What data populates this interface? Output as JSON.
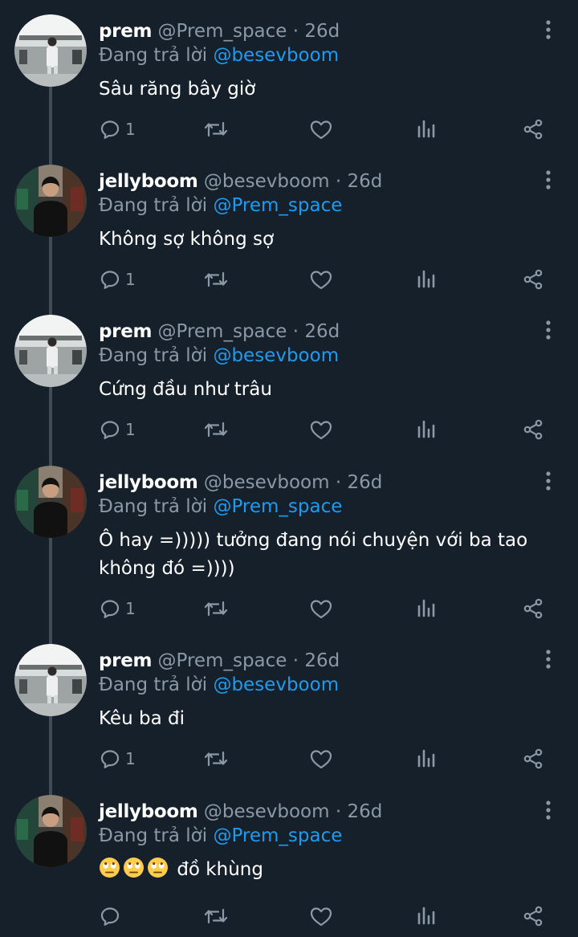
{
  "reply_prefix": "Đang trả lời",
  "tweets": [
    {
      "name": "prem",
      "handle": "@Prem_space",
      "time": "26d",
      "reply_to": "@besevboom",
      "text": "Sâu răng bây giờ",
      "emoji_count": 0,
      "reply_count": "1",
      "avatar": "prem"
    },
    {
      "name": "jellyboom",
      "handle": "@besevboom",
      "time": "26d",
      "reply_to": "@Prem_space",
      "text": "Không sợ không sợ",
      "emoji_count": 0,
      "reply_count": "1",
      "avatar": "jelly"
    },
    {
      "name": "prem",
      "handle": "@Prem_space",
      "time": "26d",
      "reply_to": "@besevboom",
      "text": "Cứng đầu như trâu",
      "emoji_count": 0,
      "reply_count": "1",
      "avatar": "prem"
    },
    {
      "name": "jellyboom",
      "handle": "@besevboom",
      "time": "26d",
      "reply_to": "@Prem_space",
      "text": "Ô hay =))))) tưởng đang nói chuyện với ba tao không đó =))))",
      "emoji_count": 0,
      "reply_count": "1",
      "avatar": "jelly"
    },
    {
      "name": "prem",
      "handle": "@Prem_space",
      "time": "26d",
      "reply_to": "@besevboom",
      "text": "Kêu ba đi",
      "emoji_count": 0,
      "reply_count": "1",
      "avatar": "prem"
    },
    {
      "name": "jellyboom",
      "handle": "@besevboom",
      "time": "26d",
      "reply_to": "@Prem_space",
      "text": "đồ khùng",
      "emoji_count": 3,
      "emoji": "face-with-rolling-eyes",
      "reply_count": "",
      "avatar": "jelly"
    }
  ],
  "icons": {
    "reply": "reply-icon",
    "retweet": "retweet-icon",
    "like": "like-icon",
    "views": "views-icon",
    "share": "share-icon",
    "more": "more-icon"
  },
  "colors": {
    "background": "#15202b",
    "text": "#ffffff",
    "muted": "#8b98a5",
    "mention": "#1d9bf0",
    "thread_line": "#3d4d5c"
  }
}
